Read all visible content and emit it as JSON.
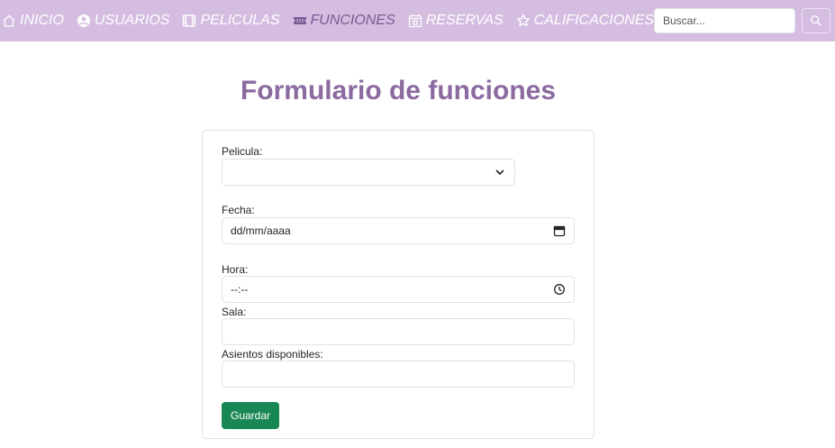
{
  "nav": {
    "items": [
      {
        "label": "INICIO",
        "icon": "home-icon"
      },
      {
        "label": "USUARIOS",
        "icon": "user-circle-icon"
      },
      {
        "label": "PELICULAS",
        "icon": "film-icon"
      },
      {
        "label": "FUNCIONES",
        "icon": "ticket-icon",
        "active": true
      },
      {
        "label": "RESERVAS",
        "icon": "calendar-icon"
      },
      {
        "label": "CALIFICACIONES",
        "icon": "star-icon"
      }
    ],
    "search_placeholder": "Buscar..."
  },
  "page": {
    "title": "Formulario de funciones"
  },
  "form": {
    "pelicula": {
      "label": "Pelicula:",
      "value": ""
    },
    "fecha": {
      "label": "Fecha:",
      "placeholder": "dd/mm/aaaa"
    },
    "hora": {
      "label": "Hora:",
      "placeholder": "--:--"
    },
    "sala": {
      "label": "Sala:",
      "value": ""
    },
    "asientos": {
      "label": "Asientos disponibles:",
      "value": ""
    },
    "save_label": "Guardar"
  },
  "colors": {
    "navbar_bg": "#d4bde0",
    "nav_text": "#ffffff",
    "nav_active": "#7a5b94",
    "title": "#8a6a9f",
    "save_button": "#198754"
  }
}
